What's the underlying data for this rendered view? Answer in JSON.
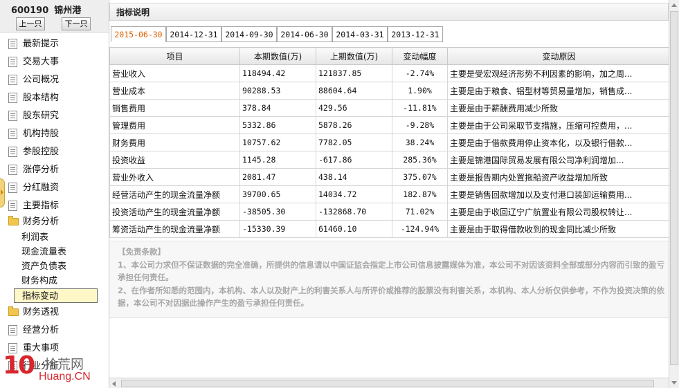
{
  "stock": {
    "code": "600190",
    "name": "锦州港"
  },
  "nav": {
    "prev_label": "上一只",
    "next_label": "下一只"
  },
  "sidebar": {
    "items": [
      {
        "label": "最新提示",
        "icon": "document-icon"
      },
      {
        "label": "交易大事",
        "icon": "document-icon"
      },
      {
        "label": "公司概况",
        "icon": "document-icon"
      },
      {
        "label": "股本结构",
        "icon": "document-icon"
      },
      {
        "label": "股东研究",
        "icon": "document-icon"
      },
      {
        "label": "机构持股",
        "icon": "document-icon"
      },
      {
        "label": "参股控股",
        "icon": "document-icon"
      },
      {
        "label": "涨停分析",
        "icon": "document-icon"
      },
      {
        "label": "分红融资",
        "icon": "document-icon"
      },
      {
        "label": "主要指标",
        "icon": "document-icon"
      }
    ],
    "finance_group": {
      "label": "财务分析",
      "icon": "folder-open-icon",
      "children": [
        "利润表",
        "现金流量表",
        "资产负债表",
        "财务构成",
        "指标变动"
      ],
      "active": "指标变动"
    },
    "items_after": [
      {
        "label": "财务透视",
        "icon": "folder-icon"
      },
      {
        "label": "经营分析",
        "icon": "document-icon"
      },
      {
        "label": "重大事项",
        "icon": "document-icon"
      },
      {
        "label": "行业分析",
        "icon": "document-icon"
      }
    ]
  },
  "panel": {
    "title": "指标说明"
  },
  "tabs": [
    "2015-06-30",
    "2014-12-31",
    "2014-09-30",
    "2014-06-30",
    "2014-03-31",
    "2013-12-31"
  ],
  "active_tab": "2015-06-30",
  "table": {
    "headers": [
      "项目",
      "本期数值(万)",
      "上期数值(万)",
      "变动幅度",
      "变动原因"
    ],
    "rows": [
      {
        "item": "营业收入",
        "current": "118494.42",
        "previous": "121837.85",
        "change": "-2.74%",
        "trend": "down",
        "reason": "主要是受宏观经济形势不利因素的影响，加之周..."
      },
      {
        "item": "营业成本",
        "current": "90288.53",
        "previous": "88604.64",
        "change": "1.90%",
        "trend": "up",
        "reason": "主要是由于粮食、铝型材等贸易量增加，销售成..."
      },
      {
        "item": "销售费用",
        "current": "378.84",
        "previous": "429.56",
        "change": "-11.81%",
        "trend": "down",
        "reason": "主要是由于薪酬费用减少所致"
      },
      {
        "item": "管理费用",
        "current": "5332.86",
        "previous": "5878.26",
        "change": "-9.28%",
        "trend": "down",
        "reason": "主要是由于公司采取节支措施，压缩可控费用，..."
      },
      {
        "item": "财务费用",
        "current": "10757.62",
        "previous": "7782.05",
        "change": "38.24%",
        "trend": "up",
        "reason": "主要是由于借款费用停止资本化，以及银行借款..."
      },
      {
        "item": "投资收益",
        "current": "1145.28",
        "previous": "-617.86",
        "change": "285.36%",
        "trend": "up",
        "reason": "主要是锦港国际贸易发展有限公司净利润增加..."
      },
      {
        "item": "营业外收入",
        "current": "2081.47",
        "previous": "438.14",
        "change": "375.07%",
        "trend": "up",
        "reason": "主要是报告期内处置拖船资产收益增加所致"
      },
      {
        "item": "经营活动产生的现金流量净额",
        "current": "39700.65",
        "previous": "14034.72",
        "change": "182.87%",
        "trend": "up",
        "reason": "主要是销售回款增加以及支付港口装卸运输费用..."
      },
      {
        "item": "投资活动产生的现金流量净额",
        "current": "-38505.30",
        "previous": "-132868.70",
        "change": "71.02%",
        "trend": "up",
        "reason": "主要是由于收回辽宁广航置业有限公司股权转让..."
      },
      {
        "item": "筹资活动产生的现金流量净额",
        "current": "-15330.39",
        "previous": "61460.10",
        "change": "-124.94%",
        "trend": "down",
        "reason": "主要是由于取得借款收到的现金同比减少所致"
      }
    ]
  },
  "disclaimer": {
    "title": "【免责条款】",
    "line1": "1、本公司力求但不保证数据的完全准确，所提供的信息请以中国证监会指定上市公司信息披露媒体为准，本公司不对因该资料全部或部分内容而引致的盈亏承担任何责任。",
    "line2": "2、在作者所知悉的范围内，本机构、本人以及财产上的利害关系人与所评价或推荐的股票没有利害关系，本机构、本人分析仅供参考，不作为投资决策的依据，本公司不对因据此操作产生的盈亏承担任何责任。"
  },
  "watermark": {
    "number": "10",
    "cn": "拾荒网",
    "en": "Huang.CN"
  },
  "colors": {
    "up": "#e01010",
    "down": "#109010",
    "active_tab": "#e06000"
  }
}
